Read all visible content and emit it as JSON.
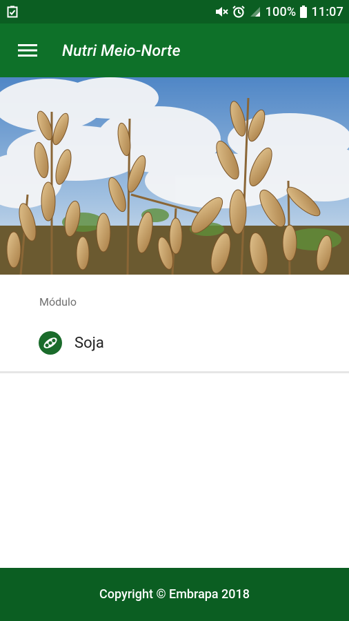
{
  "status_bar": {
    "battery": "100%",
    "time": "11:07",
    "icons": [
      "clipboard-check-icon",
      "mute-icon",
      "alarm-icon",
      "signal-icon",
      "battery-icon"
    ]
  },
  "app_bar": {
    "title": "Nutri Meio-Norte",
    "menu_icon": "hamburger-menu-icon"
  },
  "hero": {
    "image": "soybean-field-photo"
  },
  "modules": {
    "section_label": "Módulo",
    "items": [
      {
        "label": "Soja",
        "icon": "soybean-icon"
      }
    ]
  },
  "footer": {
    "text": "Copyright © Embrapa 2018"
  },
  "colors": {
    "status_bar": "#0b5e22",
    "app_bar": "#0e7129",
    "footer": "#0b5e22",
    "icon_green": "#1a6b2b"
  }
}
